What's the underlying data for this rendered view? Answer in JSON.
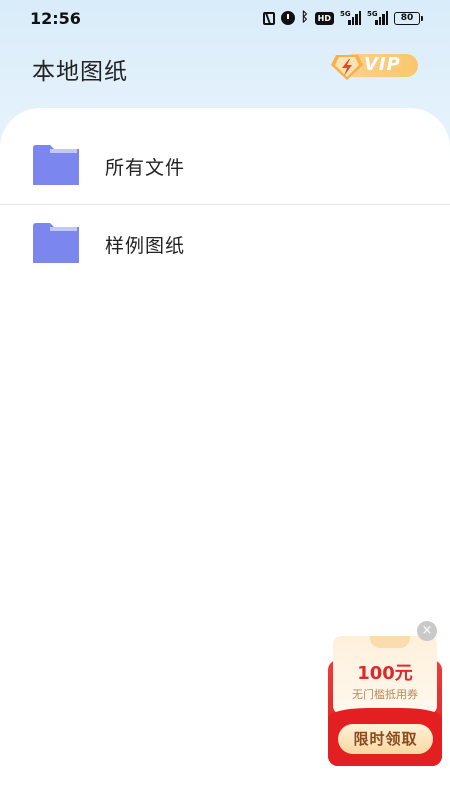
{
  "status_bar": {
    "time": "12:56",
    "network_1": "5G",
    "network_2": "5G",
    "hd_label": "HD",
    "battery": "80"
  },
  "header": {
    "title": "本地图纸",
    "vip_label": "VIP"
  },
  "list": {
    "items": [
      {
        "label": "所有文件",
        "icon": "folder-icon"
      },
      {
        "label": "样例图纸",
        "icon": "folder-icon"
      }
    ]
  },
  "coupon": {
    "amount": "100元",
    "subtitle": "无门槛抵用券",
    "button_label": "限时领取",
    "close_symbol": "×"
  },
  "colors": {
    "folder": "#7b86ee",
    "accent_red": "#e31f22",
    "vip_gold": "#f9c66d"
  }
}
